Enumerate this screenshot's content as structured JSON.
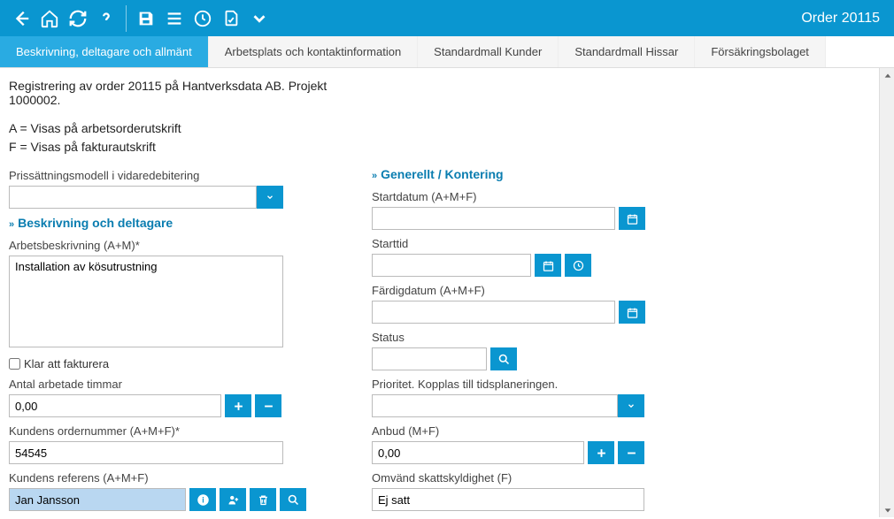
{
  "header": {
    "title": "Order 20115"
  },
  "tabs": [
    {
      "label": "Beskrivning, deltagare och allmänt",
      "active": true
    },
    {
      "label": "Arbetsplats och kontaktinformation",
      "active": false
    },
    {
      "label": "Standardmall Kunder",
      "active": false
    },
    {
      "label": "Standardmall Hissar",
      "active": false
    },
    {
      "label": "Försäkringsbolaget",
      "active": false
    }
  ],
  "intro": "Registrering av order 20115 på Hantverksdata AB. Projekt 1000002.",
  "note_a": "A = Visas på arbetsorderutskrift",
  "note_f": "F = Visas på fakturautskrift",
  "left": {
    "pricing_label": "Prissättningsmodell i vidaredebitering",
    "pricing_value": "",
    "section_desc": "Beskrivning och deltagare",
    "work_desc_label": "Arbetsbeskrivning (A+M)*",
    "work_desc_value": "Installation av kösutrustning",
    "ready_invoice_label": "Klar att fakturera",
    "hours_label": "Antal arbetade timmar",
    "hours_value": "0,00",
    "cust_order_label": "Kundens ordernummer (A+M+F)*",
    "cust_order_value": "54545",
    "cust_ref_label": "Kundens referens (A+M+F)",
    "cust_ref_value": "Jan Jansson"
  },
  "right": {
    "section_gen": "Generellt / Kontering",
    "startdate_label": "Startdatum (A+M+F)",
    "startdate_value": "",
    "starttime_label": "Starttid",
    "starttime_value": "",
    "enddate_label": "Färdigdatum (A+M+F)",
    "enddate_value": "",
    "status_label": "Status",
    "status_value": "",
    "priority_label": "Prioritet. Kopplas till tidsplaneringen.",
    "priority_value": "",
    "bid_label": "Anbud (M+F)",
    "bid_value": "0,00",
    "reverse_tax_label": "Omvänd skattskyldighet (F)",
    "reverse_tax_value": "Ej satt"
  }
}
